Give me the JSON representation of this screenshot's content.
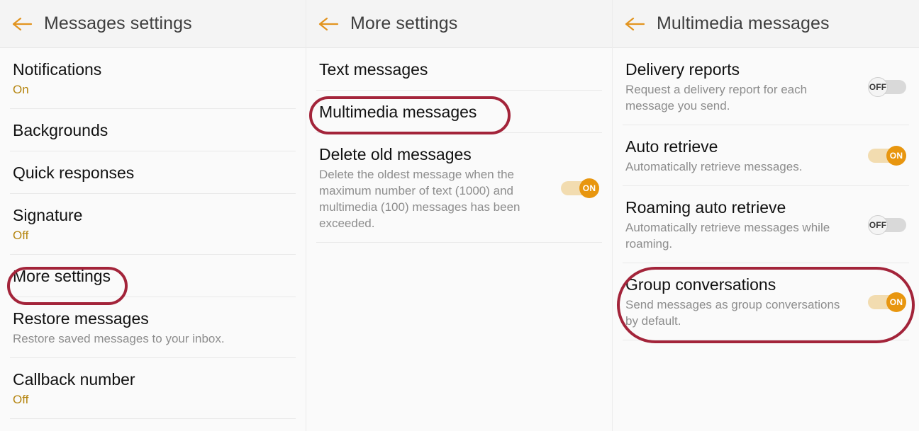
{
  "panels": [
    {
      "title": "Messages settings",
      "back_icon": "back-arrow-icon",
      "rows": [
        {
          "title": "Notifications",
          "sub": "On",
          "sub_style": "accent"
        },
        {
          "title": "Backgrounds",
          "sub": "",
          "sub_style": "none"
        },
        {
          "title": "Quick responses",
          "sub": "",
          "sub_style": "none"
        },
        {
          "title": "Signature",
          "sub": "Off",
          "sub_style": "accent"
        },
        {
          "title": "More settings",
          "sub": "",
          "sub_style": "none",
          "highlighted": true
        },
        {
          "title": "Restore messages",
          "sub": "Restore saved messages to your inbox.",
          "sub_style": "muted"
        },
        {
          "title": "Callback number",
          "sub": "Off",
          "sub_style": "accent"
        }
      ]
    },
    {
      "title": "More settings",
      "back_icon": "back-arrow-icon",
      "rows": [
        {
          "title": "Text messages",
          "sub": "",
          "sub_style": "none"
        },
        {
          "title": "Multimedia messages",
          "sub": "",
          "sub_style": "none",
          "highlighted": true
        },
        {
          "title": "Delete old messages",
          "sub": "Delete the oldest message when the maximum number of text (1000) and multimedia (100) messages has been exceeded.",
          "sub_style": "muted",
          "toggle": "ON"
        }
      ]
    },
    {
      "title": "Multimedia messages",
      "back_icon": "back-arrow-icon",
      "rows": [
        {
          "title": "Delivery reports",
          "sub": "Request a delivery report for each message you send.",
          "sub_style": "muted",
          "toggle": "OFF"
        },
        {
          "title": "Auto retrieve",
          "sub": "Automatically retrieve messages.",
          "sub_style": "muted",
          "toggle": "ON"
        },
        {
          "title": "Roaming auto retrieve",
          "sub": "Automatically retrieve messages while roaming.",
          "sub_style": "muted",
          "toggle": "OFF"
        },
        {
          "title": "Group conversations",
          "sub": "Send messages as group conversations by default.",
          "sub_style": "muted",
          "toggle": "ON",
          "highlighted": true
        }
      ]
    }
  ],
  "toggle_labels": {
    "on": "ON",
    "off": "OFF"
  },
  "colors": {
    "accent_orange": "#e8960f",
    "highlight_red": "#a3243a",
    "title_text": "#111111",
    "sub_text": "#8d8d8d",
    "accent_text": "#b5850f",
    "header_bg": "#f4f4f4",
    "panel_bg": "#fafafa"
  }
}
